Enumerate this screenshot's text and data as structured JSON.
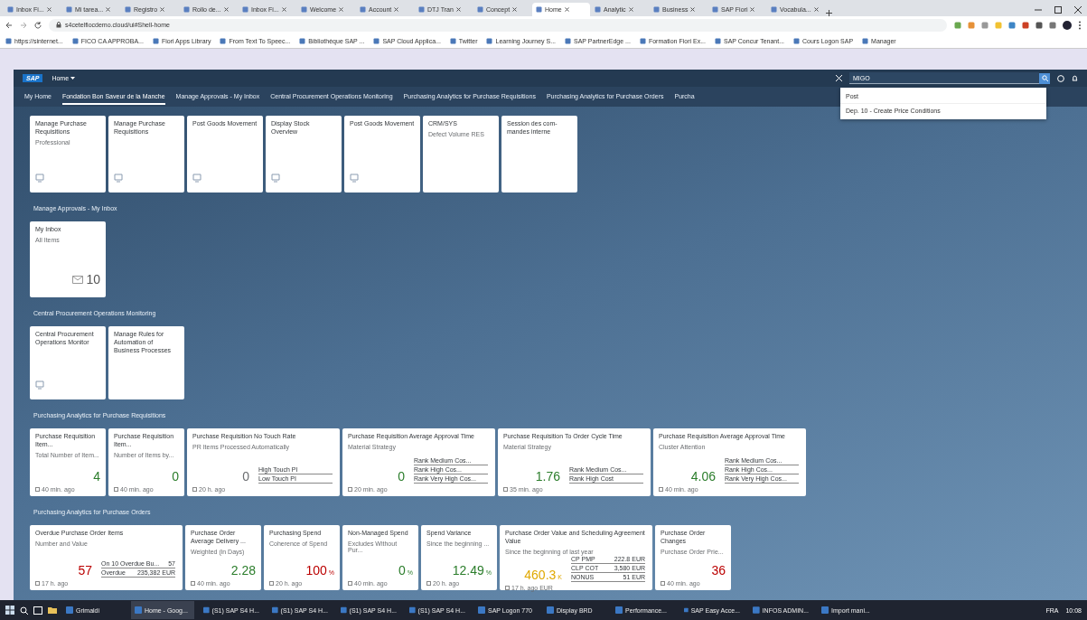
{
  "browser": {
    "tabs": [
      {
        "label": "Inbox Fi...",
        "selected": false
      },
      {
        "label": "Mi tarea...",
        "selected": false
      },
      {
        "label": "Registro",
        "selected": false
      },
      {
        "label": "Rollo de...",
        "selected": false
      },
      {
        "label": "Inbox Fi...",
        "selected": false
      },
      {
        "label": "Welcome",
        "selected": false
      },
      {
        "label": "Account",
        "selected": false
      },
      {
        "label": "DTJ Tran",
        "selected": false
      },
      {
        "label": "Concept",
        "selected": false
      },
      {
        "label": "Home",
        "selected": true
      },
      {
        "label": "Analytic",
        "selected": false
      },
      {
        "label": "Business",
        "selected": false
      },
      {
        "label": "SAP Fiori",
        "selected": false
      },
      {
        "label": "Vocabula...",
        "selected": false
      }
    ],
    "address": "s4cetelfiocdemo.cloud/ui#Shell-home",
    "bookmarks": [
      "https://sinternet...",
      "FICO CA APPROBA...",
      "Fiori Apps Library",
      "From Text To Speec...",
      "Bibliothèque SAP ...",
      "SAP Cloud Applica...",
      "Twitter",
      "Learning Journey S...",
      "SAP PartnerEdge ...",
      "Formation Fiori Ex...",
      "SAP Concur Tenant...",
      "Cours Logon SAP",
      "Manager"
    ]
  },
  "shell": {
    "logo": "SAP",
    "title": "Home",
    "search": {
      "value": "MIGO"
    },
    "suggestions": [
      "Post",
      "Dep. 10 - Create Price Conditions"
    ]
  },
  "nav": [
    {
      "label": "My Home",
      "selected": false
    },
    {
      "label": "Fondation Bon Saveur de la Manche",
      "selected": true
    },
    {
      "label": "Manage Approvals - My Inbox",
      "selected": false
    },
    {
      "label": "Central Procurement Operations Monitoring",
      "selected": false
    },
    {
      "label": "Purchasing Analytics for Purchase Requisitions",
      "selected": false
    },
    {
      "label": "Purchasing Analytics for Purchase Orders",
      "selected": false
    },
    {
      "label": "Purcha",
      "selected": false
    }
  ],
  "groups": [
    {
      "tiles": [
        {
          "kind": "app",
          "title": "Manage Purchase Requisitions",
          "subtitle": "Professional"
        },
        {
          "kind": "app",
          "title": "Manage Purchase Requisitions"
        },
        {
          "kind": "app",
          "title": "Post Goods Movement"
        },
        {
          "kind": "app",
          "title": "Display Stock Overview"
        },
        {
          "kind": "app",
          "title": "Post Goods Movement"
        },
        {
          "kind": "link",
          "title": "CRM/SYS",
          "subtitle": "Defect Volume RES"
        },
        {
          "kind": "link",
          "title": "Session des com- mandes interne"
        }
      ]
    },
    {
      "title": "Manage Approvals - My Inbox",
      "tiles": [
        {
          "kind": "counter",
          "title": "My Inbox",
          "subtitle": "All Items",
          "value": "10"
        }
      ]
    },
    {
      "title": "Central Procurement Operations Monitoring",
      "tiles": [
        {
          "kind": "app",
          "title": "Central Procurement Operations Monitor"
        },
        {
          "kind": "link",
          "title": "Manage Rules for Automation of Business Processes"
        }
      ]
    },
    {
      "title": "Purchasing Analytics for Purchase Requisitions",
      "tiles": [
        {
          "kind": "kpi",
          "title": "Purchase Requisition Item...",
          "subtitle": "Total Number of Item...",
          "value": "4",
          "color": "#2b7d2b",
          "footer": "40 min. ago"
        },
        {
          "kind": "kpi",
          "title": "Purchase Requisition Item...",
          "subtitle": "Number of Items by...",
          "value": "0",
          "color": "#2b7d2b",
          "footer": "40 min. ago"
        },
        {
          "kind": "kpi",
          "title": "Purchase Requisition No Touch Rate",
          "subtitle": "PR Items Processed Automatically",
          "value": "0",
          "color": "#6a6d70",
          "footer": "20 h. ago",
          "items": [
            {
              "label": "High Touch PI"
            },
            {
              "label": "Low Touch PI"
            }
          ]
        },
        {
          "kind": "kpi",
          "title": "Purchase Requisition Average Approval Time",
          "subtitle": "Material Strategy",
          "value": "0",
          "color": "#2b7d2b",
          "footer": "20 min. ago",
          "items": [
            {
              "label": "Rank Medium Cos..."
            },
            {
              "label": "Rank High Cos..."
            },
            {
              "label": "Rank Very High Cos..."
            }
          ]
        },
        {
          "kind": "kpi",
          "title": "Purchase Requisition To Order Cycle Time",
          "subtitle": "Material Strategy",
          "value": "1.76",
          "color": "#2b7d2b",
          "footer": "35 min. ago",
          "items": [
            {
              "label": "Rank Medium Cos..."
            },
            {
              "label": "Rank High Cost"
            }
          ]
        },
        {
          "kind": "kpi",
          "title": "Purchase Requisition Average Approval Time",
          "subtitle": "Cluster Attention",
          "value": "4.06",
          "color": "#2b7d2b",
          "footer": "40 min. ago",
          "items": [
            {
              "label": "Rank Medium Cos..."
            },
            {
              "label": "Rank High Cos..."
            },
            {
              "label": "Rank Very High Cos..."
            }
          ]
        }
      ]
    },
    {
      "title": "Purchasing Analytics for Purchase Orders",
      "tiles": [
        {
          "kind": "kpi",
          "title": "Overdue Purchase Order Items",
          "subtitle": "Number and Value",
          "value": "57",
          "color": "#bb0000",
          "footer": "17 h. ago",
          "items": [
            {
              "label": "On 10 Overdue Bu...",
              "value": "57"
            },
            {
              "label": "Overdue",
              "value": "235,382 EUR"
            }
          ]
        },
        {
          "kind": "kpi",
          "title": "Purchase Order Average Delivery ...",
          "subtitle": "Weighted (in Days)",
          "value": "2.28",
          "color": "#2b7d2b",
          "footer": "40 min. ago"
        },
        {
          "kind": "kpi",
          "title": "Purchasing Spend",
          "subtitle": "Coherence of Spend",
          "value": "100",
          "unit": "%",
          "color": "#bb0000",
          "footer": "20 h. ago"
        },
        {
          "kind": "kpi",
          "title": "Non-Managed Spend",
          "subtitle": "Excludes Without Pur...",
          "value": "0",
          "unit": "%",
          "color": "#2b7d2b",
          "footer": "40 min. ago"
        },
        {
          "kind": "kpi",
          "title": "Spend Variance",
          "subtitle": "Since the beginning ...",
          "value": "12.49",
          "unit": "%",
          "color": "#2b7d2b",
          "footer": "20 h. ago"
        },
        {
          "kind": "kpi",
          "title": "Purchase Order Value and Scheduling Agreement Value",
          "subtitle": "Since the beginning of last year",
          "value": "460.3",
          "unit": "K",
          "color": "#e0a800",
          "footer": "17 h. ago EUR",
          "items": [
            {
              "label": "CP PMP",
              "value": "222.8 EUR"
            },
            {
              "label": "CLP COT",
              "value": "3,580 EUR"
            },
            {
              "label": "NONUS",
              "value": "51 EUR"
            }
          ]
        },
        {
          "kind": "kpi",
          "title": "Purchase Order Changes",
          "subtitle": "Purchase Order Prie...",
          "value": "36",
          "color": "#bb0000",
          "footer": "40 min. ago"
        }
      ]
    }
  ],
  "taskbar": {
    "apps": [
      {
        "label": "Grimaldi",
        "selected": false
      },
      {
        "label": "Home - Goog...",
        "selected": true
      },
      {
        "label": "(S1) SAP S4 H...",
        "selected": false
      },
      {
        "label": "(S1) SAP S4 H...",
        "selected": false
      },
      {
        "label": "(S1) SAP S4 H...",
        "selected": false
      },
      {
        "label": "(S1) SAP S4 H...",
        "selected": false
      },
      {
        "label": "SAP Logon 770",
        "selected": false
      },
      {
        "label": "Display BRD",
        "selected": false
      },
      {
        "label": "Performance...",
        "selected": false
      },
      {
        "label": "SAP Easy Acce...",
        "selected": false
      },
      {
        "label": "INFOS ADMIN...",
        "selected": false
      },
      {
        "label": "Import mani...",
        "selected": false
      }
    ],
    "lang": "FRA",
    "time": "10:08"
  }
}
